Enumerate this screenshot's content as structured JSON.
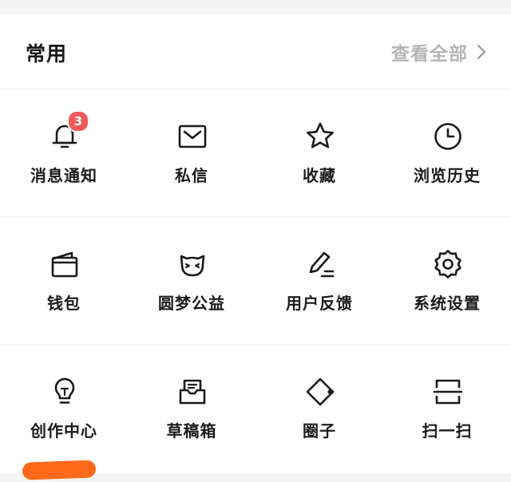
{
  "header": {
    "title": "常用",
    "view_all": "查看全部"
  },
  "accent_colors": {
    "badge": "#f25a5a",
    "redaction": "#ff6a1a",
    "muted": "#b5b5b5"
  },
  "items": [
    {
      "label": "消息通知",
      "icon": "bell-icon",
      "badge": "3"
    },
    {
      "label": "私信",
      "icon": "envelope-icon"
    },
    {
      "label": "收藏",
      "icon": "star-icon"
    },
    {
      "label": "浏览历史",
      "icon": "clock-icon"
    },
    {
      "label": "钱包",
      "icon": "wallet-icon"
    },
    {
      "label": "圆梦公益",
      "icon": "cat-face-icon"
    },
    {
      "label": "用户反馈",
      "icon": "pencil-icon"
    },
    {
      "label": "系统设置",
      "icon": "gear-icon"
    },
    {
      "label": "创作中心",
      "icon": "lightbulb-icon"
    },
    {
      "label": "草稿箱",
      "icon": "draft-box-icon"
    },
    {
      "label": "圈子",
      "icon": "circle-icon"
    },
    {
      "label": "扫一扫",
      "icon": "scan-icon"
    }
  ]
}
